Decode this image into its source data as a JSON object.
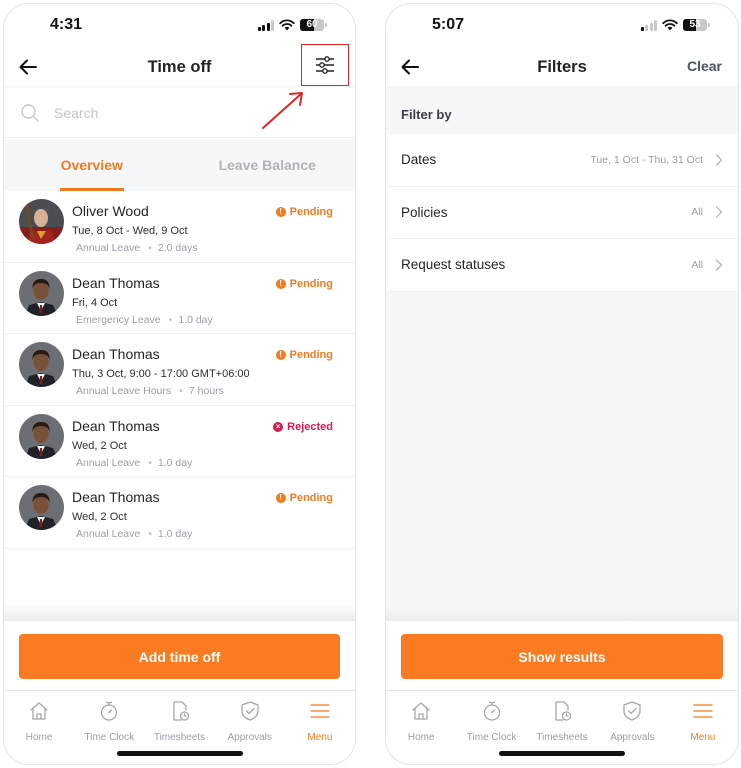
{
  "colors": {
    "accent": "#fb7b22",
    "pending": "#f47a20",
    "rejected": "#d81b50",
    "annotation": "#e02424"
  },
  "left_screen": {
    "status_bar": {
      "time": "4:31",
      "battery": "60",
      "battery_level": 0.6
    },
    "nav": {
      "title": "Time off",
      "back_icon": "arrow-left-icon",
      "filter_icon": "sliders-icon"
    },
    "search": {
      "placeholder": "Search",
      "value": ""
    },
    "tabs": [
      {
        "label": "Overview",
        "active": true
      },
      {
        "label": "Leave Balance",
        "active": false
      }
    ],
    "requests": [
      {
        "name": "Oliver Wood",
        "dates": "Tue, 8 Oct - Wed, 9 Oct",
        "policy": "Annual Leave",
        "amount": "2.0 days",
        "status": "Pending",
        "status_icon": "!"
      },
      {
        "name": "Dean Thomas",
        "dates": "Fri, 4 Oct",
        "policy": "Emergency Leave",
        "amount": "1.0 day",
        "status": "Pending",
        "status_icon": "!"
      },
      {
        "name": "Dean Thomas",
        "dates": "Thu, 3 Oct, 9:00 - 17:00 GMT+06:00",
        "policy": "Annual Leave Hours",
        "amount": "7 hours",
        "status": "Pending",
        "status_icon": "!"
      },
      {
        "name": "Dean Thomas",
        "dates": "Wed, 2 Oct",
        "policy": "Annual Leave",
        "amount": "1.0 day",
        "status": "Rejected",
        "status_icon": "×"
      },
      {
        "name": "Dean Thomas",
        "dates": "Wed, 2 Oct",
        "policy": "Annual Leave",
        "amount": "1.0 day",
        "status": "Pending",
        "status_icon": "!"
      }
    ],
    "primary_button": "Add time off"
  },
  "right_screen": {
    "status_bar": {
      "time": "5:07",
      "battery": "53",
      "battery_level": 0.53
    },
    "nav": {
      "title": "Filters",
      "back_icon": "arrow-left-icon",
      "clear_label": "Clear"
    },
    "filter_header": "Filter by",
    "filters": [
      {
        "label": "Dates",
        "value": "Tue, 1 Oct - Thu, 31 Oct"
      },
      {
        "label": "Policies",
        "value": "All"
      },
      {
        "label": "Request statuses",
        "value": "All"
      }
    ],
    "primary_button": "Show results"
  },
  "tab_bar": [
    {
      "label": "Home",
      "icon": "home-icon",
      "active": false
    },
    {
      "label": "Time Clock",
      "icon": "stopwatch-icon",
      "active": false
    },
    {
      "label": "Timesheets",
      "icon": "timesheet-icon",
      "active": false
    },
    {
      "label": "Approvals",
      "icon": "shield-check-icon",
      "active": false
    },
    {
      "label": "Menu",
      "icon": "menu-icon",
      "active": true
    }
  ]
}
